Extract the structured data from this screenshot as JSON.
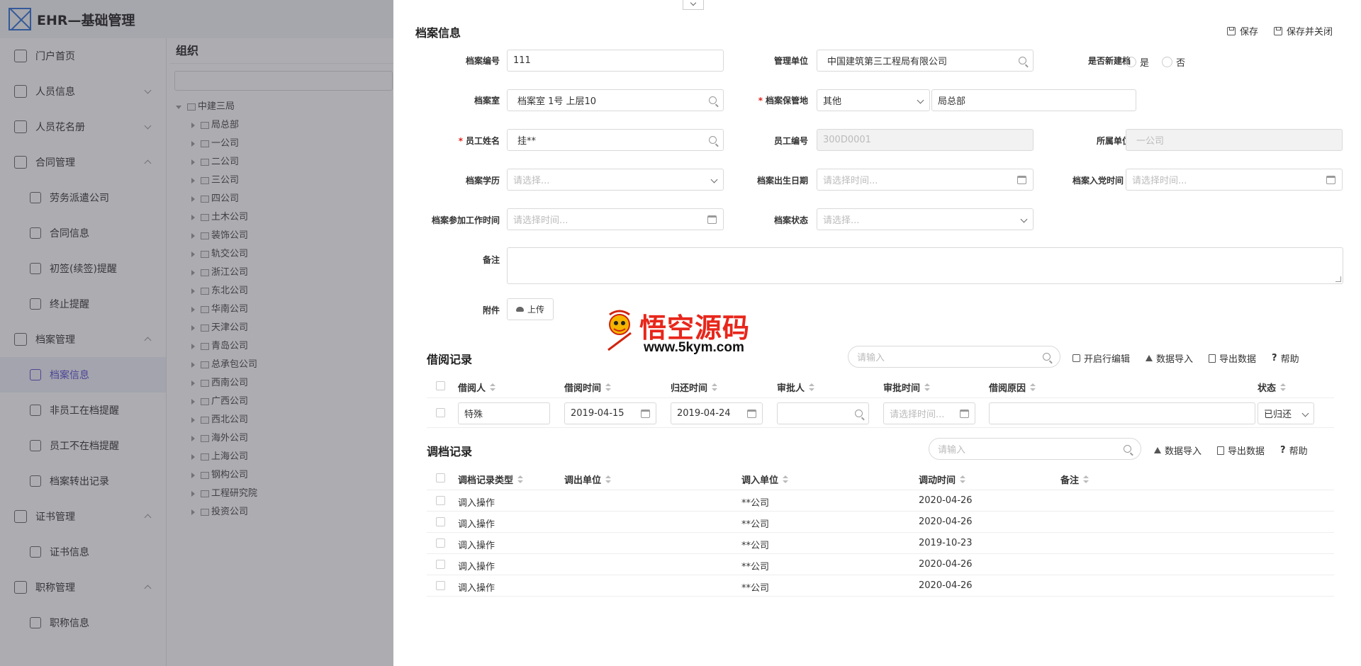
{
  "app": {
    "title": "EHR—基础管理"
  },
  "sidebar": {
    "items": [
      {
        "label": "门户首页",
        "icon": "home-icon",
        "level": 1
      },
      {
        "label": "人员信息",
        "icon": "person-card-icon",
        "level": 1,
        "arrow": "down"
      },
      {
        "label": "人员花名册",
        "icon": "person-icon",
        "level": 1,
        "arrow": "down"
      },
      {
        "label": "合同管理",
        "icon": "contract-icon",
        "level": 1,
        "arrow": "up"
      },
      {
        "label": "劳务派遣公司",
        "icon": "company-icon",
        "level": 2
      },
      {
        "label": "合同信息",
        "icon": "contract-info-icon",
        "level": 2
      },
      {
        "label": "初签(续签)提醒",
        "icon": "hand-icon",
        "level": 2
      },
      {
        "label": "终止提醒",
        "icon": "chart-icon",
        "level": 2
      },
      {
        "label": "档案管理",
        "icon": "archive-icon",
        "level": 1,
        "arrow": "up"
      },
      {
        "label": "档案信息",
        "icon": "archive-info-icon",
        "level": 2,
        "active": true
      },
      {
        "label": "非员工在档提醒",
        "icon": "list-icon",
        "level": 2
      },
      {
        "label": "员工不在档提醒",
        "icon": "list-icon",
        "level": 2
      },
      {
        "label": "档案转出记录",
        "icon": "list-icon",
        "level": 2
      },
      {
        "label": "证书管理",
        "icon": "certificate-icon",
        "level": 1,
        "arrow": "up"
      },
      {
        "label": "证书信息",
        "icon": "certificate-info-icon",
        "level": 2
      },
      {
        "label": "职称管理",
        "icon": "title-icon",
        "level": 1,
        "arrow": "up"
      },
      {
        "label": "职称信息",
        "icon": "title-info-icon",
        "level": 2
      }
    ]
  },
  "org": {
    "title": "组织",
    "root": "中建三局",
    "children": [
      "局总部",
      "一公司",
      "二公司",
      "三公司",
      "四公司",
      "土木公司",
      "装饰公司",
      "轨交公司",
      "浙江公司",
      "东北公司",
      "华南公司",
      "天津公司",
      "青岛公司",
      "总承包公司",
      "西南公司",
      "广西公司",
      "西北公司",
      "海外公司",
      "上海公司",
      "钢构公司",
      "工程研究院",
      "投资公司"
    ]
  },
  "drawer": {
    "title": "档案信息",
    "save_label": "保存",
    "save_close_label": "保存并关闭",
    "form": {
      "archive_no": {
        "label": "档案编号",
        "value": "111"
      },
      "mgmt_unit": {
        "label": "管理单位",
        "value": "中国建筑第三工程局有限公司"
      },
      "is_new": {
        "label": "是否新建档",
        "yes": "是",
        "no": "否"
      },
      "archive_room": {
        "label": "档案室",
        "value": "档案室 1号 上层10"
      },
      "storage_place": {
        "label": "档案保管地",
        "select_value": "其他",
        "value": "局总部"
      },
      "employee_name": {
        "label": "员工姓名",
        "value": "挂**"
      },
      "employee_no": {
        "label": "员工编号",
        "value": "300D0001"
      },
      "unit": {
        "label": "所属单位",
        "value": "一公司"
      },
      "education": {
        "label": "档案学历",
        "placeholder": "请选择..."
      },
      "birth_date": {
        "label": "档案出生日期",
        "placeholder": "请选择时间..."
      },
      "party_date": {
        "label": "档案入党时间",
        "placeholder": "请选择时间..."
      },
      "work_date": {
        "label": "档案参加工作时间",
        "placeholder": "请选择时间..."
      },
      "status": {
        "label": "档案状态",
        "placeholder": "请选择..."
      },
      "remark": {
        "label": "备注"
      },
      "attachment": {
        "label": "附件",
        "upload_label": "上传"
      }
    },
    "watermark": {
      "text": "悟空源码",
      "url": "www.5kym.com"
    },
    "borrow": {
      "title": "借阅记录",
      "search_placeholder": "请输入",
      "actions": [
        "开启行编辑",
        "数据导入",
        "导出数据",
        "帮助"
      ],
      "columns": [
        "借阅人",
        "借阅时间",
        "归还时间",
        "审批人",
        "审批时间",
        "借阅原因",
        "状态"
      ],
      "row": {
        "borrower": "特殊",
        "borrow_time": "2019-04-15",
        "return_time": "2019-04-24",
        "approver": "",
        "approve_time_placeholder": "请选择时间...",
        "reason": "",
        "status": "已归还"
      }
    },
    "transfer": {
      "title": "调档记录",
      "search_placeholder": "请输入",
      "actions": [
        "数据导入",
        "导出数据",
        "帮助"
      ],
      "columns": [
        "调档记录类型",
        "调出单位",
        "调入单位",
        "调动时间",
        "备注"
      ],
      "rows": [
        {
          "type": "调入操作",
          "out_unit": "",
          "in_unit": "**公司",
          "time": "2020-04-26",
          "remark": ""
        },
        {
          "type": "调入操作",
          "out_unit": "",
          "in_unit": "**公司",
          "time": "2020-04-26",
          "remark": ""
        },
        {
          "type": "调入操作",
          "out_unit": "",
          "in_unit": "**公司",
          "time": "2019-10-23",
          "remark": ""
        },
        {
          "type": "调入操作",
          "out_unit": "",
          "in_unit": "**公司",
          "time": "2020-04-26",
          "remark": ""
        },
        {
          "type": "调入操作",
          "out_unit": "",
          "in_unit": "**公司",
          "time": "2020-04-26",
          "remark": ""
        }
      ]
    }
  },
  "colors": {
    "accent": "#5a4bd1",
    "required": "#e2231a",
    "watermark": "#e8261b"
  }
}
